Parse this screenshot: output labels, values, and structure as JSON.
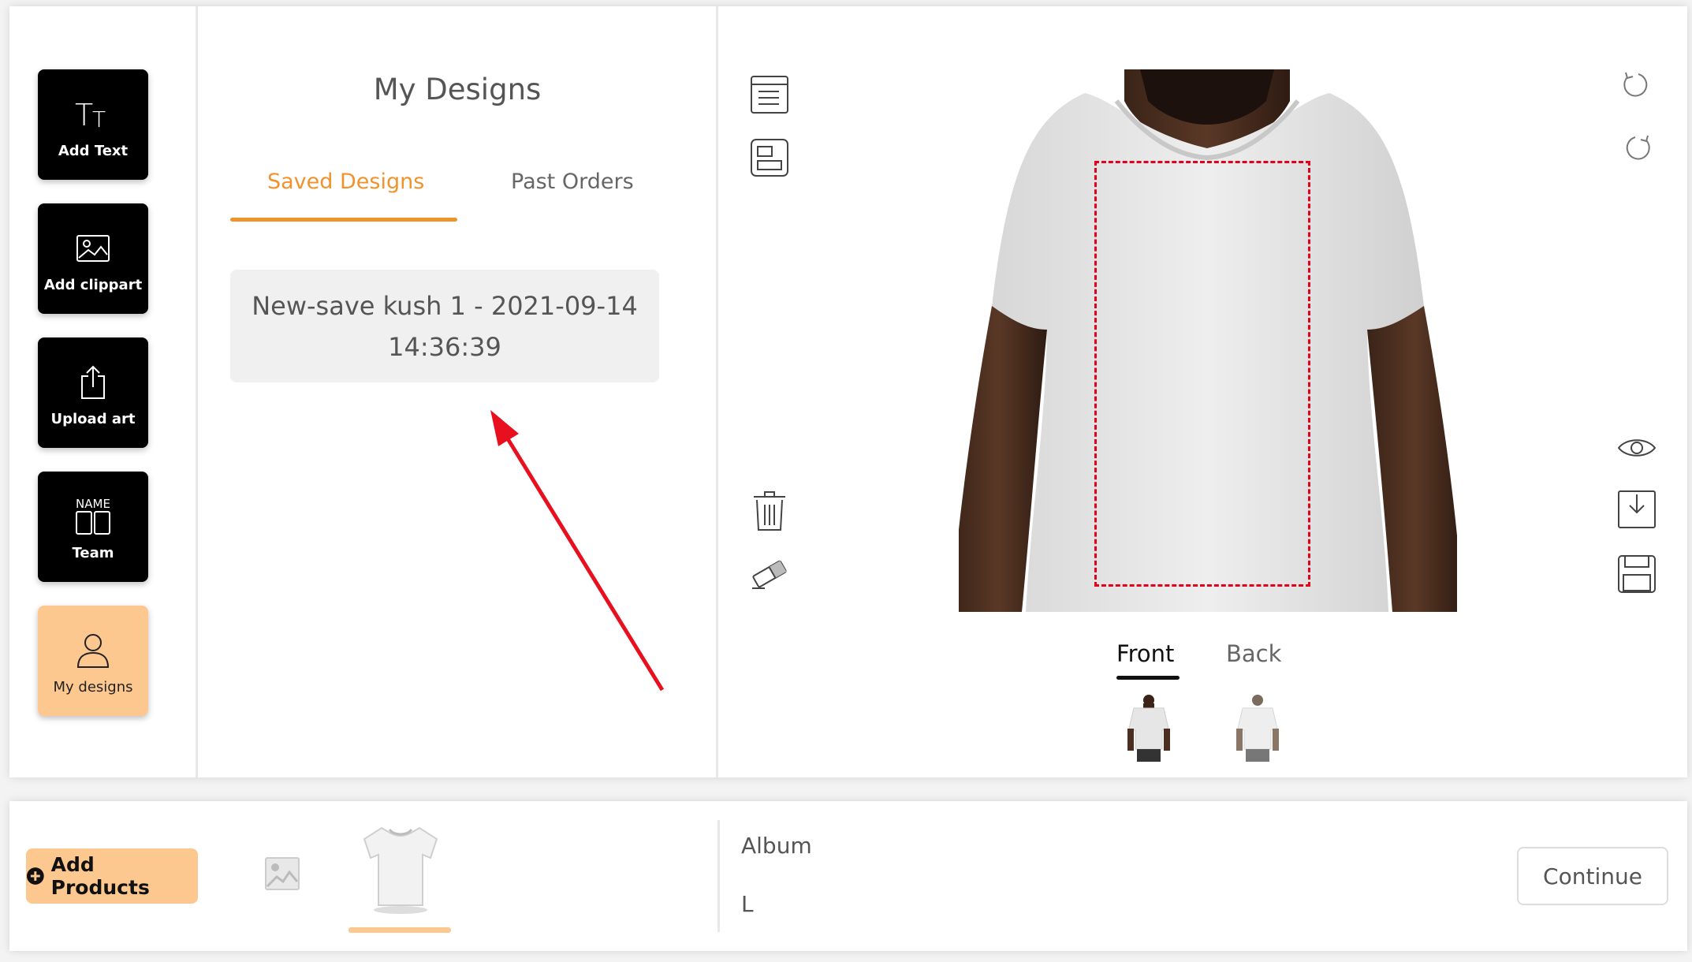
{
  "sidebar": {
    "items": [
      {
        "label": "Add Text"
      },
      {
        "label": "Add clippart"
      },
      {
        "label": "Upload art"
      },
      {
        "label": "Team",
        "icon_text": "NAME"
      },
      {
        "label": "My designs"
      }
    ]
  },
  "designs": {
    "title": "My Designs",
    "tabs": [
      {
        "label": "Saved Designs",
        "active": true
      },
      {
        "label": "Past Orders",
        "active": false
      }
    ],
    "saved": [
      {
        "name": "New-save kush 1 - 2021-09-14 14:36:39"
      }
    ]
  },
  "preview": {
    "sides": [
      {
        "label": "Front",
        "active": true
      },
      {
        "label": "Back",
        "active": false
      }
    ]
  },
  "bottom": {
    "add_products_label": "Add Products",
    "album_label": "Album",
    "size_value": "L",
    "continue_label": "Continue"
  },
  "colors": {
    "accent": "#f0932d",
    "active_tool_bg": "#fdc790",
    "print_area_border": "#e3001b",
    "annotation_arrow": "#e8101e"
  }
}
